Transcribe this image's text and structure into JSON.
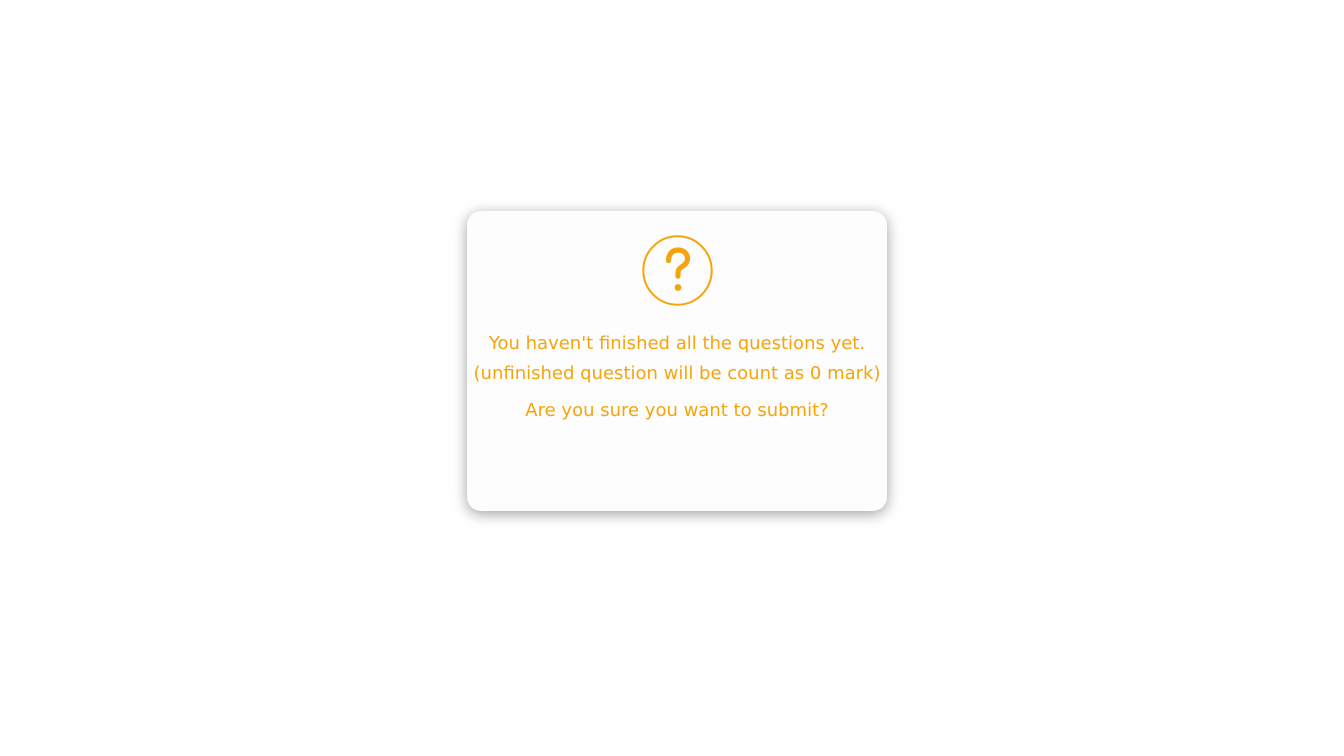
{
  "dialog": {
    "icon": "question-mark-circle-icon",
    "accent_color": "#f5a40c",
    "message_line_1": "You haven't finished all the questions yet.",
    "message_line_2": "(unfinished question will be count as 0 mark)",
    "confirm_question": "Are you sure you want to submit?"
  }
}
